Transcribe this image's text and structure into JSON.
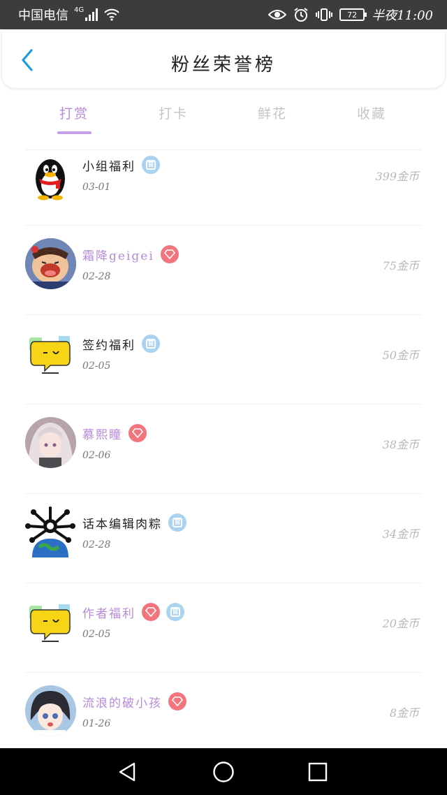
{
  "status_bar": {
    "carrier": "中国电信",
    "network": "4G",
    "battery": "72",
    "time": "半夜11:00"
  },
  "header": {
    "title": "粉丝荣誉榜",
    "back_icon": "chevron-left-icon"
  },
  "tabs": [
    {
      "label": "打赏",
      "active": true
    },
    {
      "label": "打卡",
      "active": false
    },
    {
      "label": "鲜花",
      "active": false
    },
    {
      "label": "收藏",
      "active": false
    }
  ],
  "colors": {
    "accent": "#b68ad8",
    "official_badge": "#a9d3f0",
    "vip_badge": "#f2747c"
  },
  "rows": [
    {
      "name": "小组福利",
      "date": "03-01",
      "coins": "399金币",
      "avatar": "penguin-avatar",
      "vip": false,
      "official": true
    },
    {
      "name": "霜降geigei",
      "date": "02-28",
      "coins": "75金币",
      "avatar": "cartoon-kid-avatar",
      "vip": true,
      "official": false
    },
    {
      "name": "签约福利",
      "date": "02-05",
      "coins": "50金币",
      "avatar": "chat-bubble-avatar",
      "vip": false,
      "official": true
    },
    {
      "name": "慕熙瞳",
      "date": "02-06",
      "coins": "38金币",
      "avatar": "anime-girl-avatar",
      "vip": true,
      "official": false
    },
    {
      "name": "话本编辑肉粽",
      "date": "02-28",
      "coins": "34金币",
      "avatar": "earth-creature-avatar",
      "vip": false,
      "official": true
    },
    {
      "name": "作者福利",
      "date": "02-05",
      "coins": "20金币",
      "avatar": "chat-bubble-avatar",
      "vip": true,
      "official": true
    },
    {
      "name": "流浪的破小孩",
      "date": "01-26",
      "coins": "8金币",
      "avatar": "anime-boy-avatar",
      "vip": true,
      "official": false
    }
  ]
}
